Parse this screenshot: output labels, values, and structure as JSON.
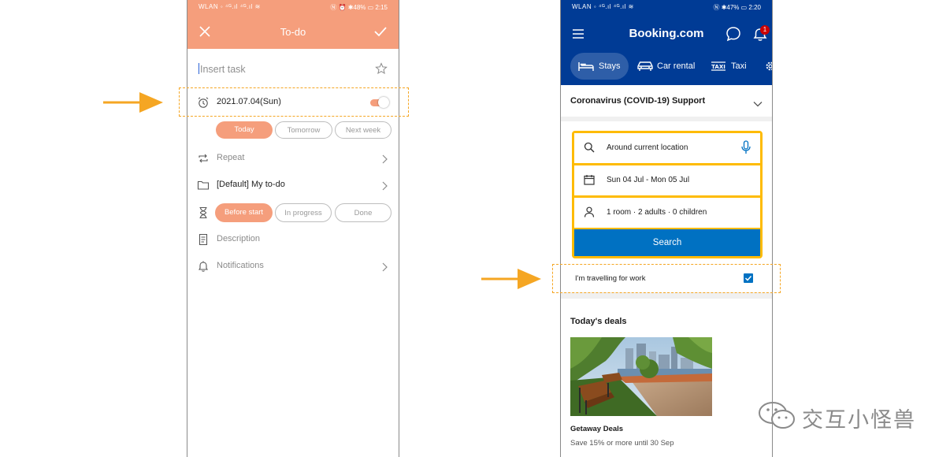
{
  "todo": {
    "status_left": "WLAN ◦ ⁴ᴳ.ıl ⁴ᴳ.ıl ≋",
    "status_right": "Ⓝ ⏰ ✱48% ▭ 2:15",
    "title": "To-do",
    "task_placeholder": "Insert task",
    "reminder_date": "2021.07.04(Sun)",
    "date_options": [
      "Today",
      "Tomorrow",
      "Next week"
    ],
    "repeat_label": "Repeat",
    "list_label": "[Default] My to-do",
    "status_options": [
      "Before start",
      "In progress",
      "Done"
    ],
    "description_label": "Description",
    "notifications_label": "Notifications",
    "accent_color": "#f59e7c"
  },
  "booking": {
    "status_left": "WLAN ◦ ⁴ᴳ.ıl ⁴ᴳ.ıl ≋",
    "status_right": "Ⓝ ✱47% ▭ 2:20",
    "brand": "Booking.com",
    "notification_count": "1",
    "tabs": [
      "Stays",
      "Car rental",
      "Taxi"
    ],
    "covid_support": "Coronavirus (COVID-19) Support",
    "location": "Around current location",
    "dates": "Sun 04 Jul - Mon 05 Jul",
    "guests": "1 room · 2 adults · 0 children",
    "search_label": "Search",
    "work_trip_label": "I'm travelling for work",
    "work_trip_checked": true,
    "deals_heading": "Today's deals",
    "deal_title": "Getaway Deals",
    "deal_subtitle": "Save 15% or more until 30 Sep",
    "brand_color": "#003b95",
    "button_color": "#0071c2",
    "highlight_color": "#febb02"
  },
  "watermark": "交互小怪兽"
}
